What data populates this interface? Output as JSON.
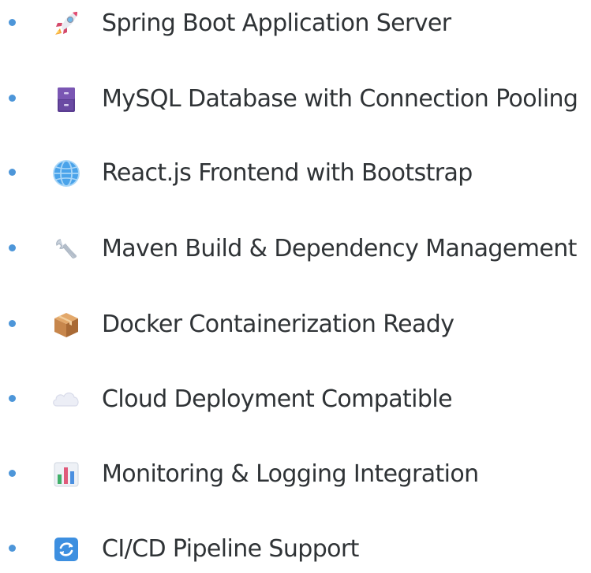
{
  "features": [
    {
      "icon": "rocket-icon",
      "label": "Spring Boot Application Server"
    },
    {
      "icon": "file-cabinet-icon",
      "label": "MySQL Database with Connection Pooling"
    },
    {
      "icon": "globe-icon",
      "label": "React.js Frontend with Bootstrap"
    },
    {
      "icon": "wrench-icon",
      "label": "Maven Build & Dependency Management"
    },
    {
      "icon": "package-icon",
      "label": "Docker Containerization Ready"
    },
    {
      "icon": "cloud-icon",
      "label": "Cloud Deployment Compatible"
    },
    {
      "icon": "bar-chart-icon",
      "label": "Monitoring & Logging Integration"
    },
    {
      "icon": "refresh-icon",
      "label": "CI/CD Pipeline Support"
    }
  ],
  "colors": {
    "bullet": "#4d96d9",
    "text": "#2f3336"
  }
}
